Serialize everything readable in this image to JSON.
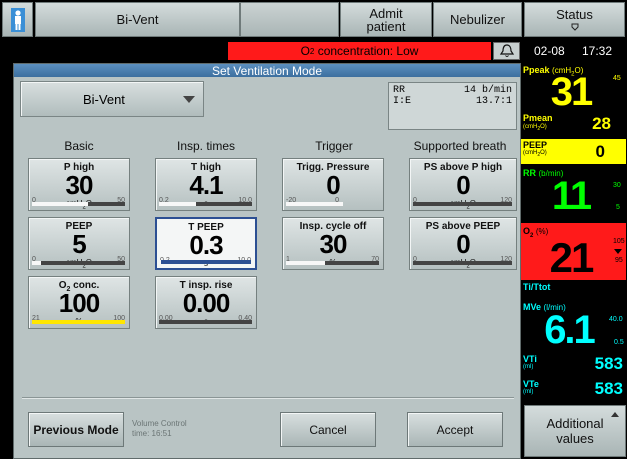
{
  "top_bar": {
    "mode_label": "Bi-Vent",
    "admit_label": "Admit\npatient",
    "nebulizer_label": "Nebulizer",
    "status_label": "Status",
    "status_icon": "ventilator-icon"
  },
  "alarm": {
    "message_prefix": "O",
    "message_sub": "2",
    "message_suffix": " concentration: Low",
    "bell_icon": "alarm-bell-icon",
    "date": "02-08",
    "time": "17:32"
  },
  "dialog": {
    "title": "Set Ventilation Mode",
    "selected_mode": "Bi-Vent",
    "info": [
      {
        "label": "RR",
        "value": "14 b/min"
      },
      {
        "label": "I:E",
        "value": "13.7:1"
      }
    ],
    "columns": [
      "Basic",
      "Insp. times",
      "Trigger",
      "Supported breath"
    ],
    "params": {
      "p_high": {
        "name": "P high",
        "value": "30",
        "unit": "cmH2O",
        "min": "0",
        "max": "50",
        "fill": 0.6
      },
      "peep": {
        "name": "PEEP",
        "value": "5",
        "unit": "cmH2O",
        "min": "0",
        "max": "50",
        "fill": 0.1
      },
      "o2_conc": {
        "name": "O2 conc.",
        "value": "100",
        "unit": "%",
        "min": "21",
        "max": "100",
        "fill": 1.0
      },
      "t_high": {
        "name": "T high",
        "value": "4.1",
        "unit": "s",
        "min": "0.2",
        "max": "10.0",
        "fill": 0.4
      },
      "t_peep": {
        "name": "T PEEP",
        "value": "0.3",
        "unit": "s",
        "min": "0.2",
        "max": "10.0",
        "fill": 0.01
      },
      "t_insp_rise": {
        "name": "T insp. rise",
        "value": "0.00",
        "unit": "s",
        "min": "0.00",
        "max": "0.40",
        "fill": 0.0
      },
      "trigg_pressure": {
        "name": "Trigg. Pressure",
        "value": "0",
        "unit": "",
        "min": "-20",
        "max": "0",
        "fill": 1.0
      },
      "insp_cycle_off": {
        "name": "Insp. cycle off",
        "value": "30",
        "unit": "%",
        "min": "1",
        "max": "70",
        "fill": 0.42
      },
      "ps_above_p_high": {
        "name": "PS above P high",
        "value": "0",
        "unit": "cmH2O",
        "min": "0",
        "max": "120",
        "fill": 0.0
      },
      "ps_above_peep": {
        "name": "PS above PEEP",
        "value": "0",
        "unit": "cmH2O",
        "min": "0",
        "max": "120",
        "fill": 0.0
      }
    },
    "previous_mode_label": "Previous Mode",
    "previous_mode_info_1": "Volume Control",
    "previous_mode_info_2": "time: 16:51",
    "cancel_label": "Cancel",
    "accept_label": "Accept"
  },
  "monitor": {
    "ppeak_label": "Ppeak",
    "ppeak_unit": "(cmH2O)",
    "ppeak_value": "31",
    "ppeak_limit": "45",
    "pmean_label": "Pmean",
    "pmean_unit": "(cmH2O)",
    "pmean_value": "28",
    "peep_label": "PEEP",
    "peep_unit": "(cmH2O)",
    "peep_value": "0",
    "rr_label": "RR",
    "rr_unit": "(b/min)",
    "rr_value": "11",
    "rr_upper": "30",
    "rr_lower": "5",
    "o2_label": "O2",
    "o2_unit": "(%)",
    "o2_value": "21",
    "o2_upper": "105",
    "o2_lower": "95",
    "ti_ttot_label": "Ti/Ttot",
    "mve_label": "MVe",
    "mve_unit": "(l/min)",
    "mve_value": "6.1",
    "mve_upper": "40.0",
    "mve_lower": "0.5",
    "vti_label": "VTi",
    "vti_unit": "(ml)",
    "vti_value": "583",
    "vte_label": "VTe",
    "vte_unit": "(ml)",
    "vte_value": "583",
    "additional_label": "Additional\nvalues"
  },
  "colors": {
    "alarm_red": "#ff1a1a",
    "monitor_yellow": "#ffff00",
    "monitor_green": "#00ff00",
    "monitor_cyan": "#00ffff",
    "dialog_title_blue": "#4a7fb0",
    "selected_border": "#2c4f93"
  }
}
